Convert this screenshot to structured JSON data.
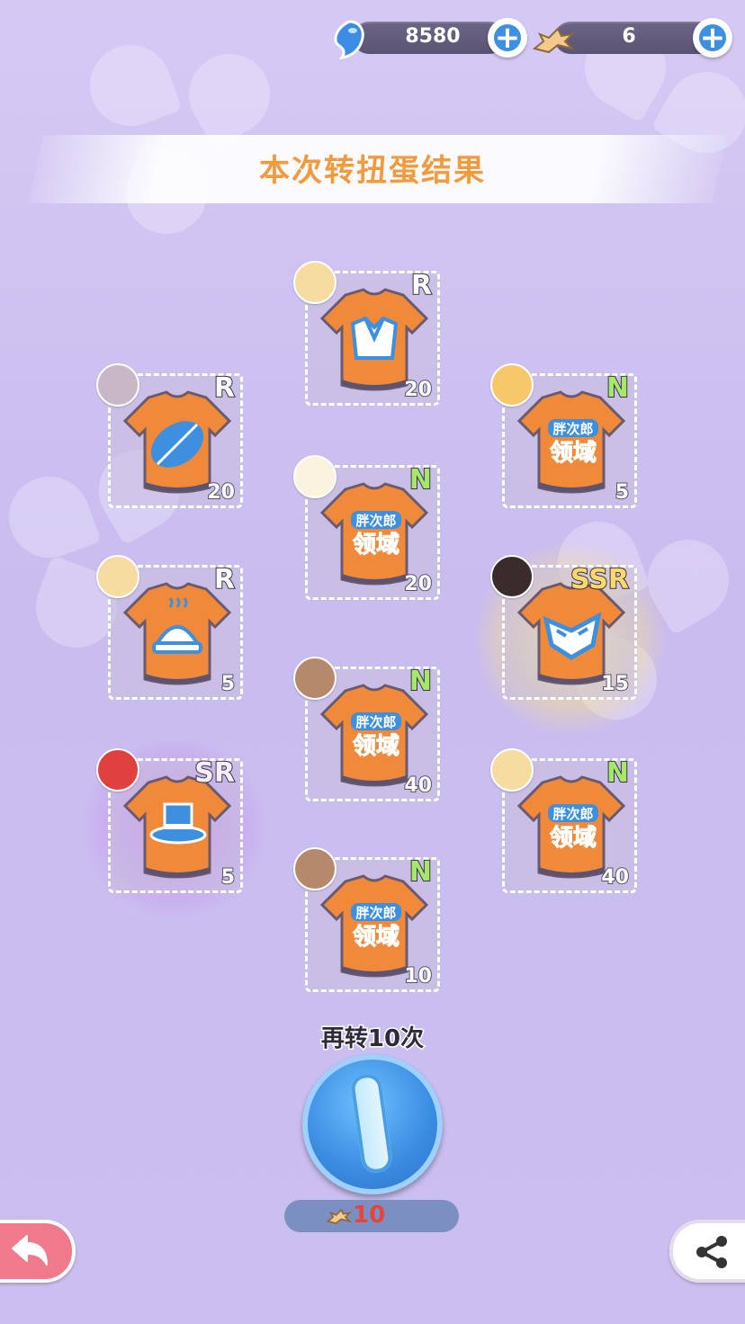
{
  "currencies": [
    {
      "name": "blue-gem",
      "value": "8580"
    },
    {
      "name": "fish-bone",
      "value": "6"
    }
  ],
  "title": "本次转扭蛋结果",
  "results": [
    {
      "id": "c1",
      "rarity": "R",
      "count": "20",
      "icon": "sailor-shirt-icon",
      "char": "cat-ear-cap-girl"
    },
    {
      "id": "c2",
      "rarity": "R",
      "count": "20",
      "icon": "leaf-hat-icon",
      "char": "pink-bow-girl"
    },
    {
      "id": "c3",
      "rarity": "N",
      "count": "5",
      "icon": "domain-logo-icon",
      "char": "fox-ear-girl"
    },
    {
      "id": "c4",
      "rarity": "N",
      "count": "20",
      "icon": "domain-logo-icon",
      "char": "white-bear-girl"
    },
    {
      "id": "c5",
      "rarity": "R",
      "count": "5",
      "icon": "steaming-food-icon",
      "char": "cat-ear-cap-girl"
    },
    {
      "id": "c6",
      "rarity": "SSR",
      "count": "15",
      "icon": "mask-icon",
      "char": "black-fox-girl"
    },
    {
      "id": "c7",
      "rarity": "N",
      "count": "40",
      "icon": "domain-logo-icon",
      "char": "brown-cat-girl"
    },
    {
      "id": "c8",
      "rarity": "SR",
      "count": "5",
      "icon": "top-hat-icon",
      "char": "red-fox-girl"
    },
    {
      "id": "c9",
      "rarity": "N",
      "count": "40",
      "icon": "domain-logo-icon",
      "char": "cat-ear-cap-girl"
    },
    {
      "id": "c10",
      "rarity": "N",
      "count": "10",
      "icon": "domain-logo-icon",
      "char": "brown-cat-girl"
    }
  ],
  "logo_text": [
    "胖次郎",
    "领域"
  ],
  "spin_again_label": "再转10次",
  "spin_cost": "10",
  "colors": {
    "accent_orange": "#f29a3c",
    "shirt_orange": "#f08a3a",
    "icon_blue": "#3d8fe0"
  }
}
